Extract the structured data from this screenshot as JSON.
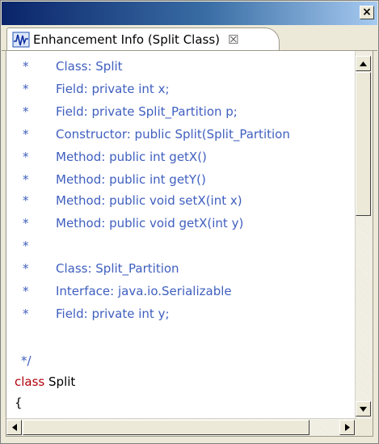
{
  "window": {
    "close_glyph": "×"
  },
  "tab": {
    "title": "Enhancement Info (Split Class)",
    "close_glyph": "☒"
  },
  "code_lines": [
    {
      "star": "*",
      "text": "Class: Split"
    },
    {
      "star": "*",
      "text": "Field: private int x;"
    },
    {
      "star": "*",
      "text": "Field: private Split_Partition p;"
    },
    {
      "star": "*",
      "text": "Constructor: public Split(Split_Partition"
    },
    {
      "star": "*",
      "text": "Method: public int getX()"
    },
    {
      "star": "*",
      "text": "Method: public int getY()"
    },
    {
      "star": "*",
      "text": "Method: public void setX(int x)"
    },
    {
      "star": "*",
      "text": "Method: public void getX(int y)"
    },
    {
      "star": "*",
      "text": ""
    },
    {
      "star": "*",
      "text": "Class: Split_Partition"
    },
    {
      "star": "*",
      "text": "Interface: java.io.Serializable"
    },
    {
      "star": "*",
      "text": "Field: private int y;"
    }
  ],
  "comment_end": "*/",
  "class_decl": {
    "keyword": "class",
    "name": "Split"
  },
  "brace": "{",
  "colors": {
    "comment": "#3f5fbf",
    "keyword": "#b0000b"
  }
}
